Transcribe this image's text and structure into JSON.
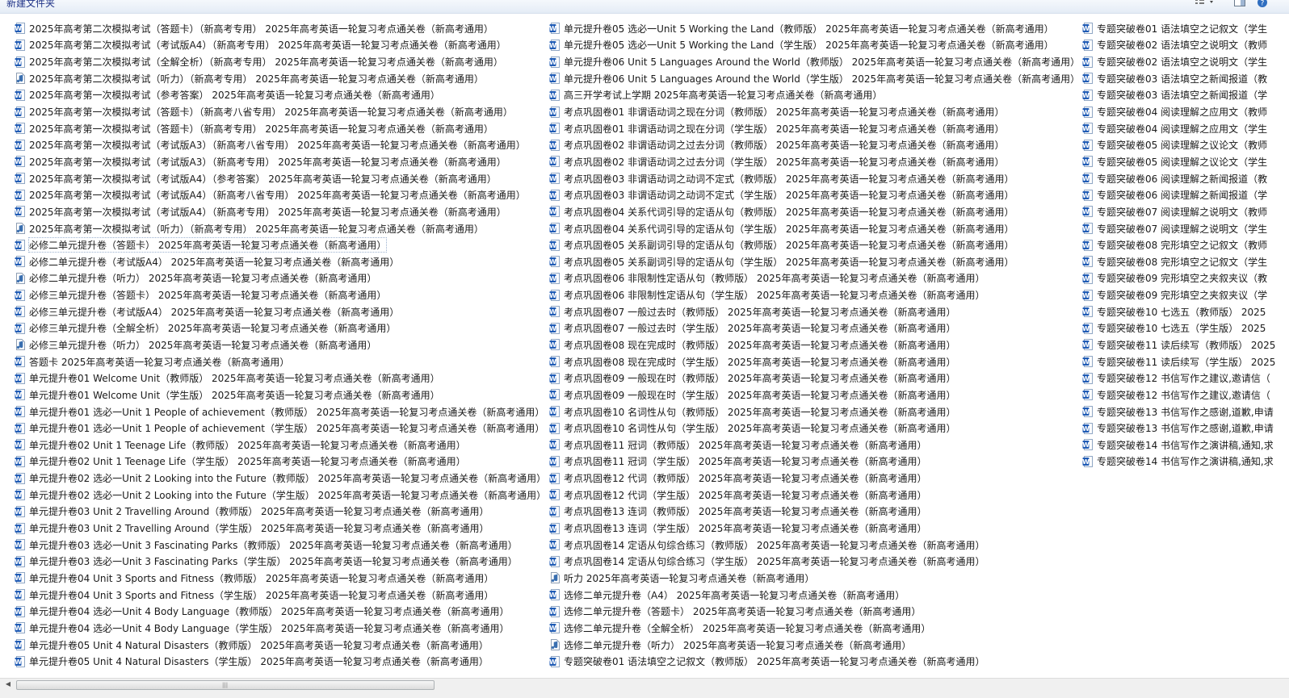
{
  "toolbar": {
    "new_folder": "新建文件夹",
    "views_icon": "views-icon",
    "preview_icon": "preview-pane-icon",
    "help_icon": "help-icon"
  },
  "colors": {
    "doc_icon": "#1f5bb5",
    "audio_icon": "#3a6fb0",
    "toolbar_text": "#1e3287"
  },
  "files": {
    "col1": [
      {
        "icon": "doc",
        "name": "2025年高考第二次模拟考试（答题卡）（新高考专用） 2025年高考英语一轮复习考点通关卷（新高考通用）"
      },
      {
        "icon": "doc",
        "name": "2025年高考第二次模拟考试（考试版A4）（新高考专用） 2025年高考英语一轮复习考点通关卷（新高考通用）"
      },
      {
        "icon": "doc",
        "name": "2025年高考第二次模拟考试（全解全析）（新高考专用） 2025年高考英语一轮复习考点通关卷（新高考通用）"
      },
      {
        "icon": "audio",
        "name": "2025年高考第二次模拟考试（听力）（新高考专用） 2025年高考英语一轮复习考点通关卷（新高考通用）"
      },
      {
        "icon": "doc",
        "name": "2025年高考第一次模拟考试（参考答案） 2025年高考英语一轮复习考点通关卷（新高考通用）"
      },
      {
        "icon": "doc",
        "name": "2025年高考第一次模拟考试（答题卡）（新高考八省专用） 2025年高考英语一轮复习考点通关卷（新高考通用）"
      },
      {
        "icon": "doc",
        "name": "2025年高考第一次模拟考试（答题卡）（新高考专用） 2025年高考英语一轮复习考点通关卷（新高考通用）"
      },
      {
        "icon": "doc",
        "name": "2025年高考第一次模拟考试（考试版A3）（新高考八省专用） 2025年高考英语一轮复习考点通关卷（新高考通用）"
      },
      {
        "icon": "doc",
        "name": "2025年高考第一次模拟考试（考试版A3）（新高考专用） 2025年高考英语一轮复习考点通关卷（新高考通用）"
      },
      {
        "icon": "doc",
        "name": "2025年高考第一次模拟考试（考试版A4）（参考答案） 2025年高考英语一轮复习考点通关卷（新高考通用）"
      },
      {
        "icon": "doc",
        "name": "2025年高考第一次模拟考试（考试版A4）（新高考八省专用） 2025年高考英语一轮复习考点通关卷（新高考通用）"
      },
      {
        "icon": "doc",
        "name": "2025年高考第一次模拟考试（考试版A4）（新高考专用） 2025年高考英语一轮复习考点通关卷（新高考通用）"
      },
      {
        "icon": "audio",
        "name": "2025年高考第一次模拟考试（听力）（新高考专用） 2025年高考英语一轮复习考点通关卷（新高考通用）"
      },
      {
        "icon": "doc",
        "name": "必修二单元提升卷（答题卡） 2025年高考英语一轮复习考点通关卷（新高考通用）",
        "selected": true
      },
      {
        "icon": "doc",
        "name": "必修二单元提升卷（考试版A4） 2025年高考英语一轮复习考点通关卷（新高考通用）"
      },
      {
        "icon": "audio",
        "name": "必修二单元提升卷（听力） 2025年高考英语一轮复习考点通关卷（新高考通用）"
      },
      {
        "icon": "doc",
        "name": "必修三单元提升卷（答题卡） 2025年高考英语一轮复习考点通关卷（新高考通用）"
      },
      {
        "icon": "doc",
        "name": "必修三单元提升卷（考试版A4） 2025年高考英语一轮复习考点通关卷（新高考通用）"
      },
      {
        "icon": "doc",
        "name": "必修三单元提升卷（全解全析） 2025年高考英语一轮复习考点通关卷（新高考通用）"
      },
      {
        "icon": "audio",
        "name": "必修三单元提升卷（听力） 2025年高考英语一轮复习考点通关卷（新高考通用）"
      },
      {
        "icon": "doc",
        "name": "答题卡 2025年高考英语一轮复习考点通关卷（新高考通用）"
      },
      {
        "icon": "doc",
        "name": "单元提升卷01 Welcome Unit（教师版） 2025年高考英语一轮复习考点通关卷（新高考通用）"
      },
      {
        "icon": "doc",
        "name": "单元提升卷01 Welcome Unit（学生版） 2025年高考英语一轮复习考点通关卷（新高考通用）"
      },
      {
        "icon": "doc",
        "name": "单元提升卷01 选必一Unit 1 People of achievement（教师版） 2025年高考英语一轮复习考点通关卷（新高考通用）"
      },
      {
        "icon": "doc",
        "name": "单元提升卷01 选必一Unit 1 People of achievement（学生版） 2025年高考英语一轮复习考点通关卷（新高考通用）"
      },
      {
        "icon": "doc",
        "name": "单元提升卷02 Unit 1 Teenage Life（教师版） 2025年高考英语一轮复习考点通关卷（新高考通用）"
      },
      {
        "icon": "doc",
        "name": "单元提升卷02 Unit 1 Teenage Life（学生版） 2025年高考英语一轮复习考点通关卷（新高考通用）"
      },
      {
        "icon": "doc",
        "name": "单元提升卷02 选必一Unit 2 Looking into the Future（教师版） 2025年高考英语一轮复习考点通关卷（新高考通用）"
      },
      {
        "icon": "doc",
        "name": "单元提升卷02 选必一Unit 2 Looking into the Future（学生版） 2025年高考英语一轮复习考点通关卷（新高考通用）"
      },
      {
        "icon": "doc",
        "name": "单元提升卷03 Unit 2 Travelling Around（教师版） 2025年高考英语一轮复习考点通关卷（新高考通用）"
      },
      {
        "icon": "doc",
        "name": "单元提升卷03 Unit 2 Travelling Around（学生版） 2025年高考英语一轮复习考点通关卷（新高考通用）"
      },
      {
        "icon": "doc",
        "name": "单元提升卷03 选必一Unit 3 Fascinating Parks（教师版） 2025年高考英语一轮复习考点通关卷（新高考通用）"
      },
      {
        "icon": "doc",
        "name": "单元提升卷03 选必一Unit 3 Fascinating Parks（学生版） 2025年高考英语一轮复习考点通关卷（新高考通用）"
      },
      {
        "icon": "doc",
        "name": "单元提升卷04 Unit 3 Sports and Fitness（教师版） 2025年高考英语一轮复习考点通关卷（新高考通用）"
      },
      {
        "icon": "doc",
        "name": "单元提升卷04 Unit 3 Sports and Fitness（学生版） 2025年高考英语一轮复习考点通关卷（新高考通用）"
      },
      {
        "icon": "doc",
        "name": "单元提升卷04 选必一Unit 4 Body Language（教师版） 2025年高考英语一轮复习考点通关卷（新高考通用）"
      },
      {
        "icon": "doc",
        "name": "单元提升卷04 选必一Unit 4 Body Language（学生版） 2025年高考英语一轮复习考点通关卷（新高考通用）"
      },
      {
        "icon": "doc",
        "name": "单元提升卷05 Unit 4 Natural Disasters（教师版） 2025年高考英语一轮复习考点通关卷（新高考通用）"
      },
      {
        "icon": "doc",
        "name": "单元提升卷05 Unit 4 Natural Disasters（学生版） 2025年高考英语一轮复习考点通关卷（新高考通用）"
      }
    ],
    "col2": [
      {
        "icon": "doc",
        "name": "单元提升卷05 选必一Unit 5 Working the Land（教师版） 2025年高考英语一轮复习考点通关卷（新高考通用）"
      },
      {
        "icon": "doc",
        "name": "单元提升卷05 选必一Unit 5 Working the Land（学生版） 2025年高考英语一轮复习考点通关卷（新高考通用）"
      },
      {
        "icon": "doc",
        "name": "单元提升卷06 Unit 5 Languages Around the World（教师版） 2025年高考英语一轮复习考点通关卷（新高考通用）"
      },
      {
        "icon": "doc",
        "name": "单元提升卷06 Unit 5 Languages Around the World（学生版） 2025年高考英语一轮复习考点通关卷（新高考通用）"
      },
      {
        "icon": "doc",
        "name": "高三开学考试上学期 2025年高考英语一轮复习考点通关卷（新高考通用）"
      },
      {
        "icon": "doc",
        "name": "考点巩固卷01 非谓语动词之现在分词（教师版） 2025年高考英语一轮复习考点通关卷（新高考通用）"
      },
      {
        "icon": "doc",
        "name": "考点巩固卷01 非谓语动词之现在分词（学生版） 2025年高考英语一轮复习考点通关卷（新高考通用）"
      },
      {
        "icon": "doc",
        "name": "考点巩固卷02 非谓语动词之过去分词（教师版） 2025年高考英语一轮复习考点通关卷（新高考通用）"
      },
      {
        "icon": "doc",
        "name": "考点巩固卷02 非谓语动词之过去分词（学生版） 2025年高考英语一轮复习考点通关卷（新高考通用）"
      },
      {
        "icon": "doc",
        "name": "考点巩固卷03 非谓语动词之动词不定式（教师版） 2025年高考英语一轮复习考点通关卷（新高考通用）"
      },
      {
        "icon": "doc",
        "name": "考点巩固卷03 非谓语动词之动词不定式（学生版） 2025年高考英语一轮复习考点通关卷（新高考通用）"
      },
      {
        "icon": "doc",
        "name": "考点巩固卷04 关系代词引导的定语从句（教师版） 2025年高考英语一轮复习考点通关卷（新高考通用）"
      },
      {
        "icon": "doc",
        "name": "考点巩固卷04 关系代词引导的定语从句（学生版） 2025年高考英语一轮复习考点通关卷（新高考通用）"
      },
      {
        "icon": "doc",
        "name": "考点巩固卷05 关系副词引导的定语从句（教师版） 2025年高考英语一轮复习考点通关卷（新高考通用）"
      },
      {
        "icon": "doc",
        "name": "考点巩固卷05 关系副词引导的定语从句（学生版） 2025年高考英语一轮复习考点通关卷（新高考通用）"
      },
      {
        "icon": "doc",
        "name": "考点巩固卷06 非限制性定语从句（教师版） 2025年高考英语一轮复习考点通关卷（新高考通用）"
      },
      {
        "icon": "doc",
        "name": "考点巩固卷06 非限制性定语从句（学生版） 2025年高考英语一轮复习考点通关卷（新高考通用）"
      },
      {
        "icon": "doc",
        "name": "考点巩固卷07 一般过去时（教师版） 2025年高考英语一轮复习考点通关卷（新高考通用）"
      },
      {
        "icon": "doc",
        "name": "考点巩固卷07 一般过去时（学生版） 2025年高考英语一轮复习考点通关卷（新高考通用）"
      },
      {
        "icon": "doc",
        "name": "考点巩固卷08 现在完成时（教师版） 2025年高考英语一轮复习考点通关卷（新高考通用）"
      },
      {
        "icon": "doc",
        "name": "考点巩固卷08 现在完成时（学生版） 2025年高考英语一轮复习考点通关卷（新高考通用）"
      },
      {
        "icon": "doc",
        "name": "考点巩固卷09 一般现在时（教师版） 2025年高考英语一轮复习考点通关卷（新高考通用）"
      },
      {
        "icon": "doc",
        "name": "考点巩固卷09 一般现在时（学生版） 2025年高考英语一轮复习考点通关卷（新高考通用）"
      },
      {
        "icon": "doc",
        "name": "考点巩固卷10 名词性从句（教师版） 2025年高考英语一轮复习考点通关卷（新高考通用）"
      },
      {
        "icon": "doc",
        "name": "考点巩固卷10 名词性从句（学生版） 2025年高考英语一轮复习考点通关卷（新高考通用）"
      },
      {
        "icon": "doc",
        "name": "考点巩固卷11 冠词（教师版） 2025年高考英语一轮复习考点通关卷（新高考通用）"
      },
      {
        "icon": "doc",
        "name": "考点巩固卷11 冠词（学生版） 2025年高考英语一轮复习考点通关卷（新高考通用）"
      },
      {
        "icon": "doc",
        "name": "考点巩固卷12 代词（教师版） 2025年高考英语一轮复习考点通关卷（新高考通用）"
      },
      {
        "icon": "doc",
        "name": "考点巩固卷12 代词（学生版） 2025年高考英语一轮复习考点通关卷（新高考通用）"
      },
      {
        "icon": "doc",
        "name": "考点巩固卷13 连词（教师版） 2025年高考英语一轮复习考点通关卷（新高考通用）"
      },
      {
        "icon": "doc",
        "name": "考点巩固卷13 连词（学生版） 2025年高考英语一轮复习考点通关卷（新高考通用）"
      },
      {
        "icon": "doc",
        "name": "考点巩固卷14 定语从句综合练习（教师版） 2025年高考英语一轮复习考点通关卷（新高考通用）"
      },
      {
        "icon": "doc",
        "name": "考点巩固卷14 定语从句综合练习（学生版） 2025年高考英语一轮复习考点通关卷（新高考通用）"
      },
      {
        "icon": "audio",
        "name": "听力 2025年高考英语一轮复习考点通关卷（新高考通用）"
      },
      {
        "icon": "doc",
        "name": "选修二单元提升卷（A4） 2025年高考英语一轮复习考点通关卷（新高考通用）"
      },
      {
        "icon": "doc",
        "name": "选修二单元提升卷（答题卡） 2025年高考英语一轮复习考点通关卷（新高考通用）"
      },
      {
        "icon": "doc",
        "name": "选修二单元提升卷（全解全析） 2025年高考英语一轮复习考点通关卷（新高考通用）"
      },
      {
        "icon": "audio",
        "name": "选修二单元提升卷（听力） 2025年高考英语一轮复习考点通关卷（新高考通用）"
      },
      {
        "icon": "doc",
        "name": "专题突破卷01 语法填空之记叙文（教师版） 2025年高考英语一轮复习考点通关卷（新高考通用）"
      }
    ],
    "col3": [
      {
        "icon": "doc",
        "name": "专题突破卷01 语法填空之记叙文（学生"
      },
      {
        "icon": "doc",
        "name": "专题突破卷02 语法填空之说明文（教师"
      },
      {
        "icon": "doc",
        "name": "专题突破卷02 语法填空之说明文（学生"
      },
      {
        "icon": "doc",
        "name": "专题突破卷03 语法填空之新闻报道（教"
      },
      {
        "icon": "doc",
        "name": "专题突破卷03 语法填空之新闻报道（学"
      },
      {
        "icon": "doc",
        "name": "专题突破卷04 阅读理解之应用文（教师"
      },
      {
        "icon": "doc",
        "name": "专题突破卷04 阅读理解之应用文（学生"
      },
      {
        "icon": "doc",
        "name": "专题突破卷05 阅读理解之议论文（教师"
      },
      {
        "icon": "doc",
        "name": "专题突破卷05 阅读理解之议论文（学生"
      },
      {
        "icon": "doc",
        "name": "专题突破卷06 阅读理解之新闻报道（教"
      },
      {
        "icon": "doc",
        "name": "专题突破卷06 阅读理解之新闻报道（学"
      },
      {
        "icon": "doc",
        "name": "专题突破卷07 阅读理解之说明文（教师"
      },
      {
        "icon": "doc",
        "name": "专题突破卷07 阅读理解之说明文（学生"
      },
      {
        "icon": "doc",
        "name": "专题突破卷08 完形填空之记叙文（教师"
      },
      {
        "icon": "doc",
        "name": "专题突破卷08 完形填空之记叙文（学生"
      },
      {
        "icon": "doc",
        "name": "专题突破卷09 完形填空之夹叙夹议（教"
      },
      {
        "icon": "doc",
        "name": "专题突破卷09 完形填空之夹叙夹议（学"
      },
      {
        "icon": "doc",
        "name": "专题突破卷10 七选五（教师版） 2025"
      },
      {
        "icon": "doc",
        "name": "专题突破卷10 七选五（学生版） 2025"
      },
      {
        "icon": "doc",
        "name": "专题突破卷11 读后续写（教师版） 2025"
      },
      {
        "icon": "doc",
        "name": "专题突破卷11 读后续写（学生版） 2025"
      },
      {
        "icon": "doc",
        "name": "专题突破卷12 书信写作之建议,邀请信（"
      },
      {
        "icon": "doc",
        "name": "专题突破卷12 书信写作之建议,邀请信（"
      },
      {
        "icon": "doc",
        "name": "专题突破卷13 书信写作之感谢,道歉,申请"
      },
      {
        "icon": "doc",
        "name": "专题突破卷13 书信写作之感谢,道歉,申请"
      },
      {
        "icon": "doc",
        "name": "专题突破卷14 书信写作之演讲稿,通知,求"
      },
      {
        "icon": "doc",
        "name": "专题突破卷14 书信写作之演讲稿,通知,求"
      }
    ]
  },
  "scrollbar": {
    "grip_icon": "scroll-grip-icon",
    "left_arrow_icon": "scroll-left-icon"
  }
}
